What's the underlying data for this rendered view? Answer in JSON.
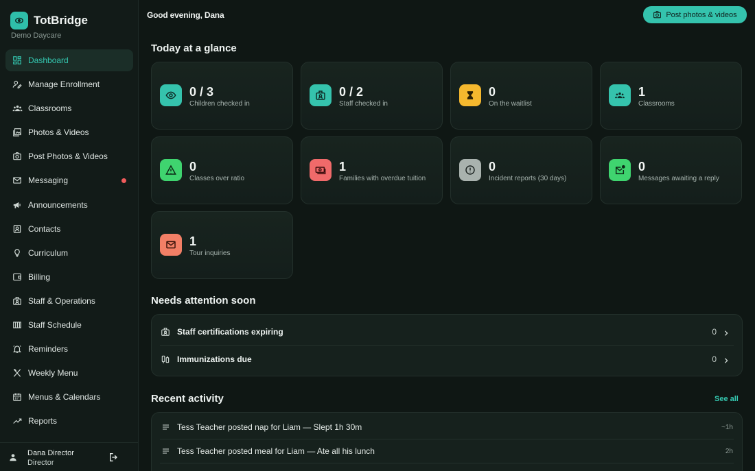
{
  "brand": {
    "name": "TotBridge",
    "subtitle": "Demo Daycare"
  },
  "nav": {
    "items": [
      {
        "label": "Dashboard",
        "icon": "dashboard-icon",
        "active": true
      },
      {
        "label": "Manage Enrollment",
        "icon": "enrollment-icon"
      },
      {
        "label": "Classrooms",
        "icon": "classrooms-icon"
      },
      {
        "label": "Photos & Videos",
        "icon": "photos-icon"
      },
      {
        "label": "Post Photos & Videos",
        "icon": "camera-icon"
      },
      {
        "label": "Messaging",
        "icon": "mail-icon",
        "badge": true
      },
      {
        "label": "Announcements",
        "icon": "megaphone-icon"
      },
      {
        "label": "Contacts",
        "icon": "contacts-icon"
      },
      {
        "label": "Curriculum",
        "icon": "lightbulb-icon"
      },
      {
        "label": "Billing",
        "icon": "wallet-icon"
      },
      {
        "label": "Staff & Operations",
        "icon": "badge-icon"
      },
      {
        "label": "Staff Schedule",
        "icon": "schedule-icon"
      },
      {
        "label": "Reminders",
        "icon": "bell-icon"
      },
      {
        "label": "Weekly Menu",
        "icon": "utensils-icon"
      },
      {
        "label": "Menus & Calendars",
        "icon": "calendar-icon"
      },
      {
        "label": "Reports",
        "icon": "trend-icon"
      }
    ]
  },
  "user": {
    "name": "Dana Director",
    "role": "Director"
  },
  "header": {
    "greeting": "Good evening, Dana",
    "post_button": "Post photos & videos"
  },
  "glance": {
    "title": "Today at a glance",
    "cards": [
      {
        "value": "0 / 3",
        "label": "Children checked in",
        "icon": "eye-icon",
        "color": "#35c3ad"
      },
      {
        "value": "0 / 2",
        "label": "Staff checked in",
        "icon": "id-badge-icon",
        "color": "#35c3ad"
      },
      {
        "value": "0",
        "label": "On the waitlist",
        "icon": "hourglass-icon",
        "color": "#f5b82e"
      },
      {
        "value": "1",
        "label": "Classrooms",
        "icon": "group-icon",
        "color": "#35c3ad"
      },
      {
        "value": "0",
        "label": "Classes over ratio",
        "icon": "warning-icon",
        "color": "#3fd46f"
      },
      {
        "value": "1",
        "label": "Families with overdue tuition",
        "icon": "cash-icon",
        "color": "#f06a6a"
      },
      {
        "value": "0",
        "label": "Incident reports (30 days)",
        "icon": "alert-circle-icon",
        "color": "#a9b2ae"
      },
      {
        "value": "0",
        "label": "Messages awaiting a reply",
        "icon": "mail-open-icon",
        "color": "#3fd46f"
      },
      {
        "value": "1",
        "label": "Tour inquiries",
        "icon": "envelope-icon",
        "color": "#f27f66"
      }
    ]
  },
  "attention": {
    "title": "Needs attention soon",
    "rows": [
      {
        "label": "Staff certifications expiring",
        "count": "0",
        "icon": "certificate-icon"
      },
      {
        "label": "Immunizations due",
        "count": "0",
        "icon": "syringe-icon"
      }
    ]
  },
  "activity": {
    "title": "Recent activity",
    "see_all": "See all",
    "rows": [
      {
        "text": "Tess Teacher posted nap for Liam — Slept 1h 30m",
        "time": "~1h"
      },
      {
        "text": "Tess Teacher posted meal for Liam — Ate all his lunch",
        "time": "2h"
      }
    ]
  }
}
